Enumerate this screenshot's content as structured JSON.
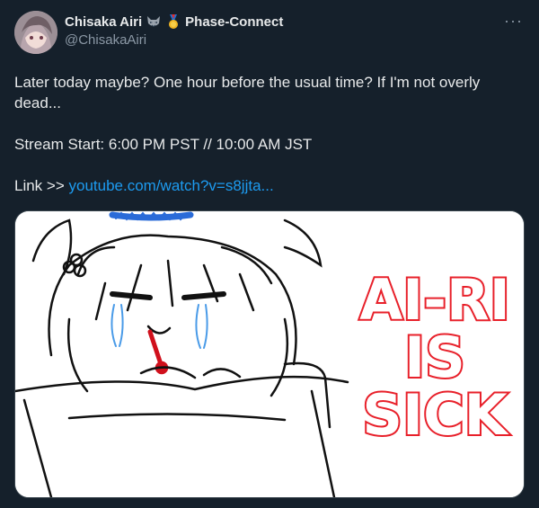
{
  "author": {
    "name": "Chisaka Airi",
    "affiliation": "Phase-Connect",
    "handle": "@ChisakaAiri"
  },
  "menu": {
    "more_label": "···"
  },
  "tweet": {
    "line1": "Later today maybe? One hour before the usual time? If I'm not overly dead...",
    "line2": "Stream Start: 6:00 PM PST // 10:00 AM JST",
    "link_prefix": "Link >> ",
    "link_text": "youtube.com/watch?v=s8jjta..."
  },
  "image": {
    "caption_line1": "AI-RI",
    "caption_line2": "IS",
    "caption_line3": "SICK",
    "caption_color": "#e8202a"
  }
}
